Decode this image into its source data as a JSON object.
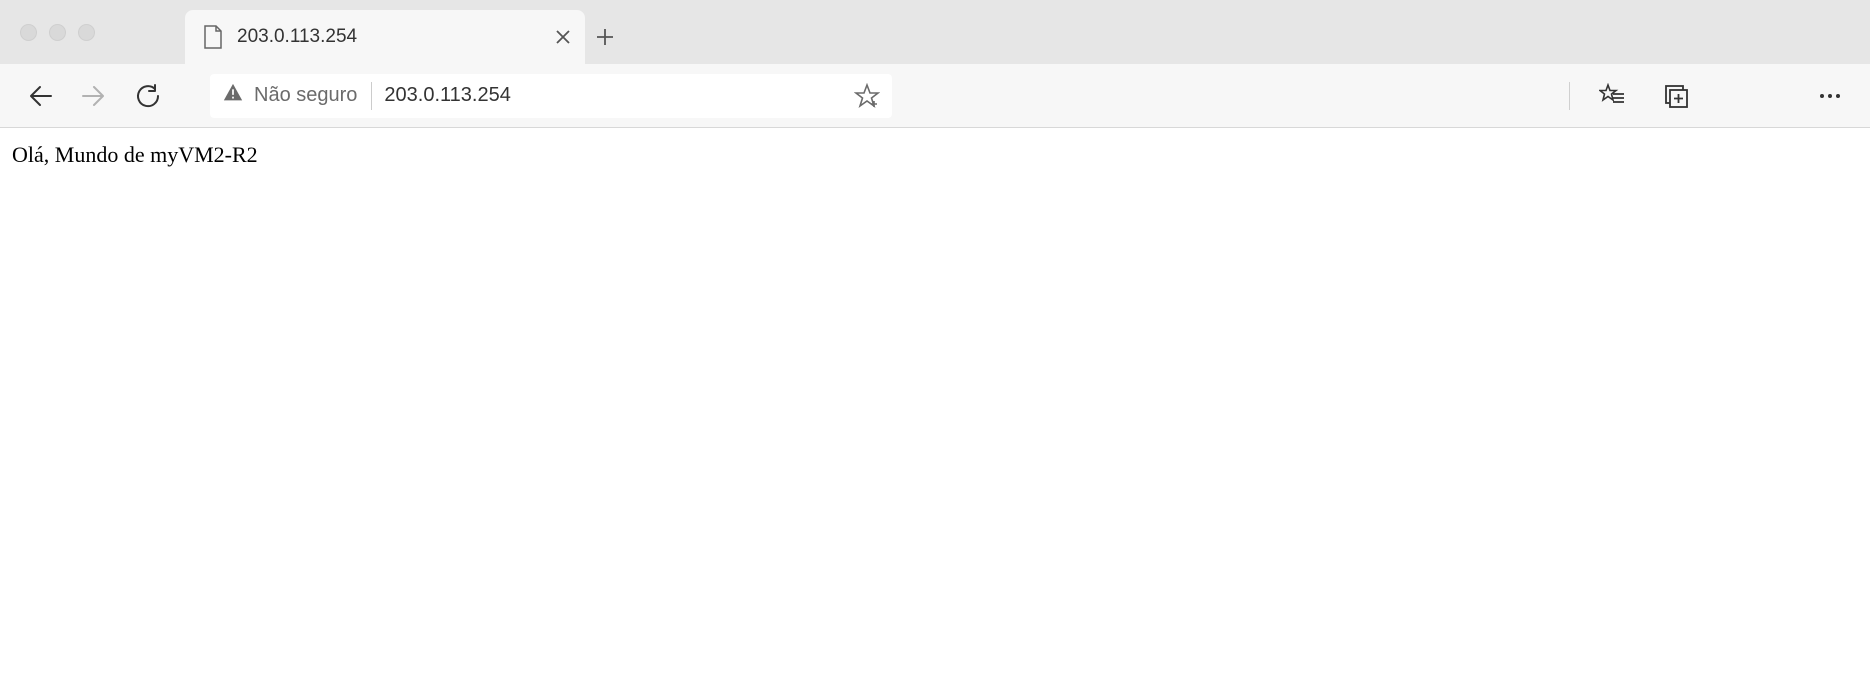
{
  "window": {
    "tab_title": "203.0.113.254"
  },
  "toolbar": {
    "security_label": "Não seguro",
    "url": "203.0.113.254"
  },
  "page": {
    "body_text": "Olá, Mundo de myVM2-R2"
  }
}
